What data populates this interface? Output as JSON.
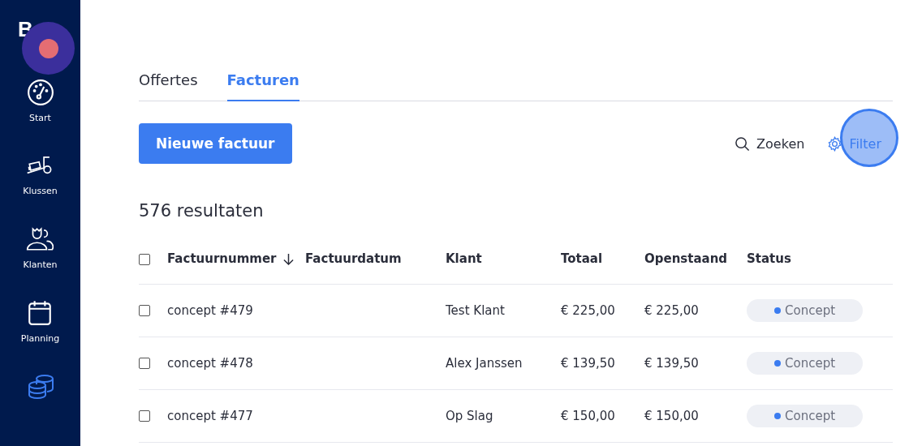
{
  "sidebar": {
    "logo": "B",
    "items": [
      {
        "label": "Start",
        "selected": false
      },
      {
        "label": "Klussen",
        "selected": false
      },
      {
        "label": "Klanten",
        "selected": false
      },
      {
        "label": "Planning",
        "selected": false
      },
      {
        "selected": true
      }
    ]
  },
  "tabs": [
    {
      "label": "Offertes",
      "selected": false
    },
    {
      "label": "Facturen",
      "selected": true
    }
  ],
  "new_button": "Nieuwe factuur",
  "search": "Zoeken",
  "filter": "Filter",
  "result_count": "576 resultaten",
  "table": {
    "all_checked": false,
    "columns": [
      "Factuurnummer",
      "Factuurdatum",
      "Klant",
      "Totaal",
      "Openstaand",
      "Status"
    ],
    "rows": [
      {
        "checked": false,
        "number": "concept #479",
        "client": "Test Klant",
        "total": "€ 225,00",
        "open": "€ 225,00",
        "status": "Concept",
        "color": "#3b7cf0"
      },
      {
        "checked": false,
        "number": "concept #478",
        "client": "Alex Janssen",
        "total": "€ 139,50",
        "open": "€ 139,50",
        "status": "Concept",
        "color": "#3b7cf0"
      },
      {
        "checked": false,
        "number": "concept #477",
        "client": "Op Slag",
        "total": "€ 150,00",
        "open": "€ 150,00",
        "status": "Concept",
        "color": "#3b7cf0"
      }
    ]
  }
}
